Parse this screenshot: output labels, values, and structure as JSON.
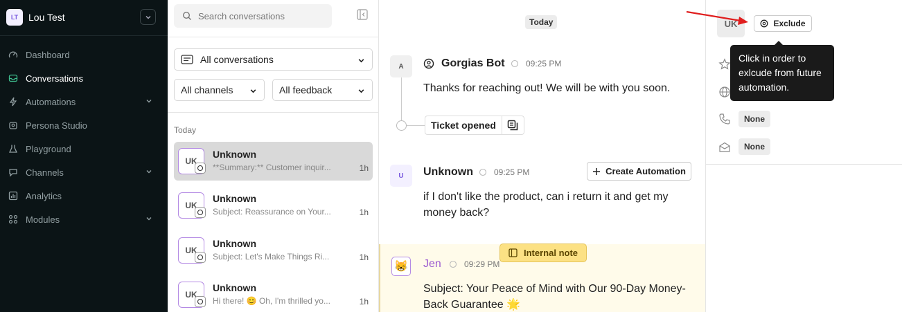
{
  "workspace": {
    "badge": "LT",
    "name": "Lou Test"
  },
  "nav": [
    {
      "label": "Dashboard",
      "icon": "dashboard-icon",
      "active": false,
      "chevron": false
    },
    {
      "label": "Conversations",
      "icon": "inbox-icon",
      "active": true,
      "chevron": false
    },
    {
      "label": "Automations",
      "icon": "bolt-icon",
      "active": false,
      "chevron": true
    },
    {
      "label": "Persona Studio",
      "icon": "persona-icon",
      "active": false,
      "chevron": false
    },
    {
      "label": "Playground",
      "icon": "flask-icon",
      "active": false,
      "chevron": false
    },
    {
      "label": "Channels",
      "icon": "channels-icon",
      "active": false,
      "chevron": true
    },
    {
      "label": "Analytics",
      "icon": "analytics-icon",
      "active": false,
      "chevron": false
    },
    {
      "label": "Modules",
      "icon": "modules-icon",
      "active": false,
      "chevron": true
    }
  ],
  "convlist": {
    "search_placeholder": "Search conversations",
    "filter_all": "All conversations",
    "filter_channels": "All channels",
    "filter_feedback": "All feedback",
    "section_label": "Today",
    "items": [
      {
        "avatar": "UK",
        "name": "Unknown",
        "preview": "**Summary:** Customer inquir...",
        "time": "1h"
      },
      {
        "avatar": "UK",
        "name": "Unknown",
        "preview": "Subject: Reassurance on Your...",
        "time": "1h"
      },
      {
        "avatar": "UK",
        "name": "Unknown",
        "preview": "Subject: Let's Make Things Ri...",
        "time": "1h"
      },
      {
        "avatar": "UK",
        "name": "Unknown",
        "preview": "Hi there! 😊 Oh, I'm thrilled yo...",
        "time": "1h"
      }
    ]
  },
  "thread": {
    "day_label": "Today",
    "messages": [
      {
        "avatar": "A",
        "sender": "Gorgias Bot",
        "time": "09:25 PM",
        "text": "Thanks for reaching out! We will be with you soon."
      },
      {
        "avatar": "U",
        "sender": "Unknown",
        "time": "09:25 PM",
        "text": "if I don't like the product, can i return it and get my money back?"
      },
      {
        "avatar": "😸",
        "sender": "Jen",
        "time": "09:29 PM",
        "text": "Subject: Your Peace of Mind with Our 90-Day Money-Back Guarantee 🌟"
      }
    ],
    "ticket_opened": "Ticket opened",
    "create_automation": "Create Automation",
    "internal_note": "Internal note"
  },
  "rpanel": {
    "avatar": "UK",
    "exclude_label": "Exclude",
    "phone_value": "None",
    "email_value": "None",
    "tooltip": "Click in order to exlcude from future automation."
  },
  "colors": {
    "sidebar_bg": "#0b1416",
    "accent_red": "#e01e1e",
    "note_bg": "#fffbea",
    "jen_purple": "#9b59d0"
  }
}
